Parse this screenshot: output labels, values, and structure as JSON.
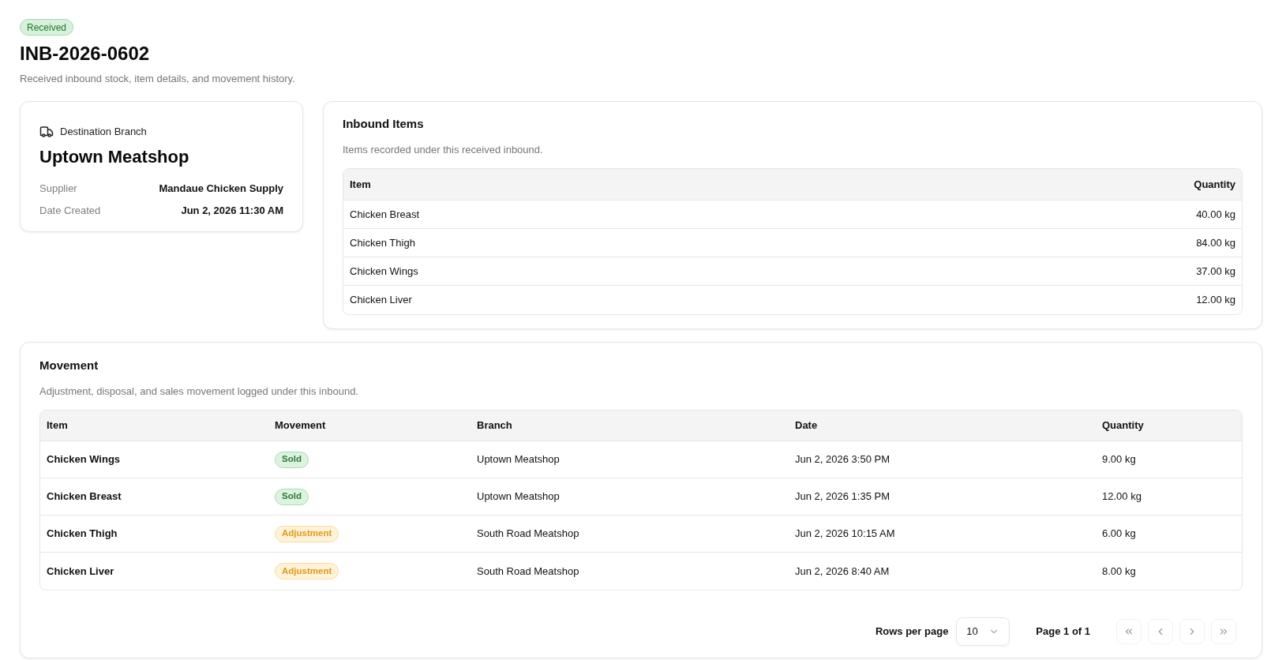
{
  "status_badge": "Received",
  "title": "INB-2026-0602",
  "subtitle": "Received inbound stock, item details, and movement history.",
  "destination_card": {
    "label": "Destination Branch",
    "branch": "Uptown Meatshop",
    "details": [
      {
        "label": "Supplier",
        "value": "Mandaue Chicken Supply"
      },
      {
        "label": "Date Created",
        "value": "Jun 2, 2026 11:30 AM"
      }
    ]
  },
  "inbound_items": {
    "title": "Inbound Items",
    "description": "Items recorded under this received inbound.",
    "columns": [
      "Item",
      "Quantity"
    ],
    "rows": [
      {
        "item": "Chicken Breast",
        "quantity": "40.00 kg"
      },
      {
        "item": "Chicken Thigh",
        "quantity": "84.00 kg"
      },
      {
        "item": "Chicken Wings",
        "quantity": "37.00 kg"
      },
      {
        "item": "Chicken Liver",
        "quantity": "12.00 kg"
      }
    ]
  },
  "movement": {
    "title": "Movement",
    "description": "Adjustment, disposal, and sales movement logged under this inbound.",
    "columns": [
      "Item",
      "Movement",
      "Branch",
      "Date",
      "Quantity"
    ],
    "rows": [
      {
        "item": "Chicken Wings",
        "movement": {
          "label": "Sold",
          "kind": "sold"
        },
        "branch": "Uptown Meatshop",
        "date": "Jun 2, 2026 3:50 PM",
        "quantity": "9.00 kg"
      },
      {
        "item": "Chicken Breast",
        "movement": {
          "label": "Sold",
          "kind": "sold"
        },
        "branch": "Uptown Meatshop",
        "date": "Jun 2, 2026 1:35 PM",
        "quantity": "12.00 kg"
      },
      {
        "item": "Chicken Thigh",
        "movement": {
          "label": "Adjustment",
          "kind": "adjustment"
        },
        "branch": "South Road Meatshop",
        "date": "Jun 2, 2026 10:15 AM",
        "quantity": "6.00 kg"
      },
      {
        "item": "Chicken Liver",
        "movement": {
          "label": "Adjustment",
          "kind": "adjustment"
        },
        "branch": "South Road Meatshop",
        "date": "Jun 2, 2026 8:40 AM",
        "quantity": "8.00 kg"
      }
    ],
    "pagination": {
      "rows_per_page_label": "Rows per page",
      "rows_per_page": "10",
      "page_label": "Page 1 of 1",
      "buttons": [
        {
          "kind": "first",
          "disabled": true
        },
        {
          "kind": "prev",
          "disabled": true
        },
        {
          "kind": "next",
          "disabled": true
        },
        {
          "kind": "last",
          "disabled": true
        }
      ]
    }
  }
}
